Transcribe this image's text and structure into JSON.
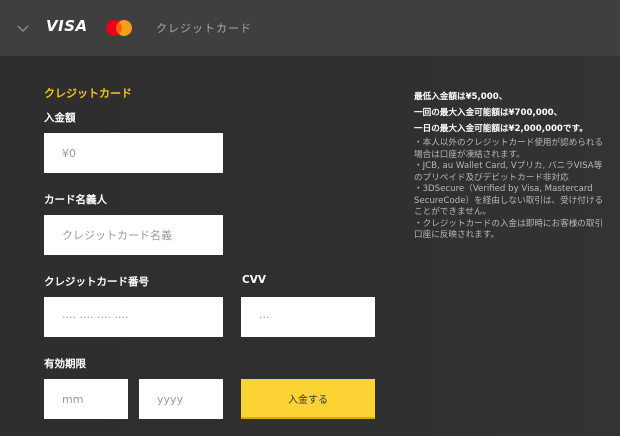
{
  "header": {
    "visa_label": "VISA",
    "method_label": "クレジットカード",
    "icons": [
      "chevron-down-icon",
      "visa-logo",
      "mastercard-logo"
    ],
    "mastercard_colors": [
      "#eb001b",
      "#f79e1b",
      "#ff5f00"
    ]
  },
  "form": {
    "section_title": "クレジットカード",
    "amount": {
      "label": "入金額",
      "placeholder": "¥0"
    },
    "holder": {
      "label": "カード名義人",
      "placeholder": "クレジットカード名義"
    },
    "number": {
      "label": "クレジットカード番号",
      "placeholder": "···· ···· ···· ····"
    },
    "cvv": {
      "label": "CVV",
      "placeholder": "···"
    },
    "expiry": {
      "label": "有効期限",
      "month_placeholder": "mm",
      "year_placeholder": "yyyy"
    },
    "submit_label": "入金する",
    "accent_color": "#f5c518",
    "button_color": "#fcd335"
  },
  "info": {
    "lines": [
      "最低入金額は¥5,000、",
      "一回の最大入金可能額は¥700,000、",
      "一日の最大入金可能額は¥2,000,000です。"
    ],
    "notes": [
      "・本人以外のクレジットカード使用が認められる場合は口座が凍結されます。",
      "・JCB, au Wallet Card, Vプリカ, バニラVISA等のプリペイド及びデビットカード非対応",
      "・3DSecure（Verified by Visa, Mastercard SecureCode）を経由しない取引は、受け付けることができません。",
      "・クレジットカードの入金は即時にお客様の取引口座に反映されます。"
    ]
  }
}
